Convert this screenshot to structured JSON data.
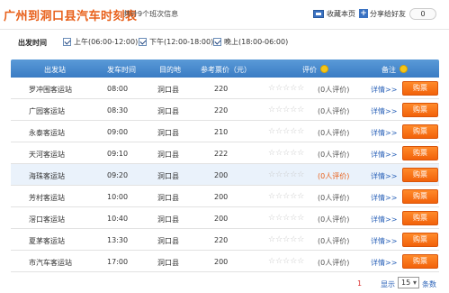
{
  "header": {
    "title": "广州到洞口县汽车时刻表",
    "count": "共计9个班次信息",
    "favorite_label": "收藏本页",
    "share_label": "分享给好友",
    "share_count": "0"
  },
  "filter": {
    "label": "出发时间",
    "options": [
      {
        "label": "上午(06:00-12:00)",
        "checked": true
      },
      {
        "label": "下午(12:00-18:00)",
        "checked": true
      },
      {
        "label": "晚上(18:00-06:00)",
        "checked": true
      }
    ]
  },
  "table": {
    "headers": {
      "station": "出发站",
      "time": "发车时间",
      "dest": "目的地",
      "price": "参考票价（元）",
      "rating": "评价",
      "note": "备注"
    },
    "detail_label": "详情>>",
    "buy_label": "购票",
    "stars": "☆☆☆☆☆",
    "rows": [
      {
        "station": "罗冲围客运站",
        "time": "08:00",
        "dest": "洞口县",
        "price": "220",
        "reviews": "(0人评价)"
      },
      {
        "station": "广园客运站",
        "time": "08:30",
        "dest": "洞口县",
        "price": "220",
        "reviews": "(0人评价)"
      },
      {
        "station": "永泰客运站",
        "time": "09:00",
        "dest": "洞口县",
        "price": "210",
        "reviews": "(0人评价)"
      },
      {
        "station": "天河客运站",
        "time": "09:10",
        "dest": "洞口县",
        "price": "222",
        "reviews": "(0人评价)"
      },
      {
        "station": "海珠客运站",
        "time": "09:20",
        "dest": "洞口县",
        "price": "200",
        "reviews": "(0人评价)"
      },
      {
        "station": "芳村客运站",
        "time": "10:00",
        "dest": "洞口县",
        "price": "200",
        "reviews": "(0人评价)"
      },
      {
        "station": "滘口客运站",
        "time": "10:40",
        "dest": "洞口县",
        "price": "200",
        "reviews": "(0人评价)"
      },
      {
        "station": "夏茅客运站",
        "time": "13:30",
        "dest": "洞口县",
        "price": "220",
        "reviews": "(0人评价)"
      },
      {
        "station": "市汽车客运站",
        "time": "17:00",
        "dest": "洞口县",
        "price": "200",
        "reviews": "(0人评价)"
      }
    ]
  },
  "footer": {
    "page": "1",
    "show_label": "显示",
    "per_page": "15",
    "unit_label": "条数"
  },
  "colors": {
    "title": "#e8601a",
    "header_bg": "#3a7cc4",
    "buy_button": "#f2620a",
    "link": "#2a62b8"
  }
}
